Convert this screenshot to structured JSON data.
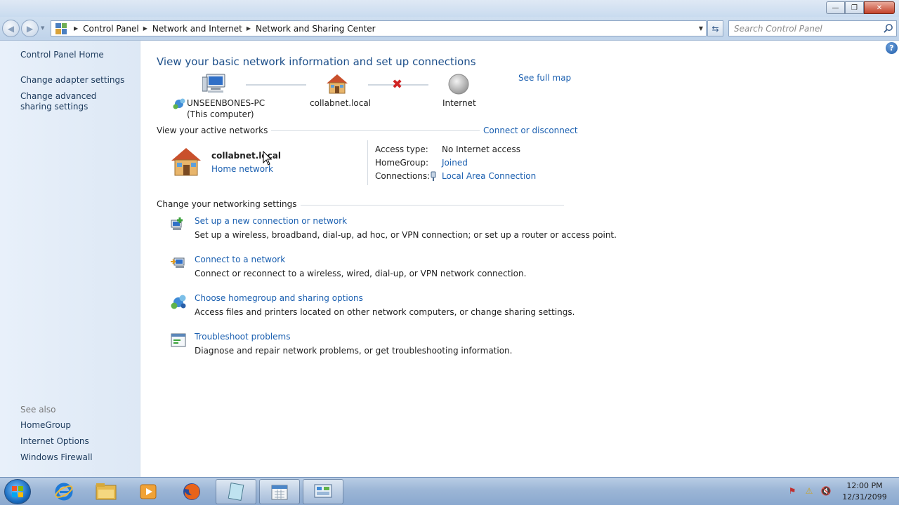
{
  "window": {
    "minimize_glyph": "—",
    "maximize_glyph": "❐",
    "close_glyph": "✕"
  },
  "nav": {
    "breadcrumb": [
      "Control Panel",
      "Network and Internet",
      "Network and Sharing Center"
    ],
    "search_placeholder": "Search Control Panel"
  },
  "sidebar": {
    "home": "Control Panel Home",
    "links": [
      "Change adapter settings",
      "Change advanced sharing settings"
    ],
    "see_also_label": "See also",
    "see_also": [
      "HomeGroup",
      "Internet Options",
      "Windows Firewall"
    ]
  },
  "main": {
    "heading": "View your basic network information and set up connections",
    "see_full_map": "See full map",
    "map": {
      "computer_name": "UNSEENBONES-PC",
      "computer_sub": "(This computer)",
      "network_name": "collabnet.local",
      "internet_label": "Internet",
      "internet_connected": false
    },
    "active_networks_title": "View your active networks",
    "connect_or_disconnect": "Connect or disconnect",
    "active_network": {
      "name": "collabnet.local",
      "type": "Home network",
      "access_type_label": "Access type:",
      "access_type_value": "No Internet access",
      "homegroup_label": "HomeGroup:",
      "homegroup_value": "Joined",
      "connections_label": "Connections:",
      "connections_value": "Local Area Connection"
    },
    "settings_title": "Change your networking settings",
    "tasks": [
      {
        "title": "Set up a new connection or network",
        "desc": "Set up a wireless, broadband, dial-up, ad hoc, or VPN connection; or set up a router or access point."
      },
      {
        "title": "Connect to a network",
        "desc": "Connect or reconnect to a wireless, wired, dial-up, or VPN network connection."
      },
      {
        "title": "Choose homegroup and sharing options",
        "desc": "Access files and printers located on other network computers, or change sharing settings."
      },
      {
        "title": "Troubleshoot problems",
        "desc": "Diagnose and repair network problems, or get troubleshooting information."
      }
    ]
  },
  "taskbar": {
    "time": "12:00 PM",
    "date": "12/31/2099",
    "pinned_icons": [
      "internet-explorer-icon",
      "windows-explorer-icon",
      "media-player-icon",
      "firefox-icon",
      "notepad-icon",
      "calendar-icon",
      "control-panel-icon"
    ]
  },
  "colors": {
    "link": "#1a5fb0",
    "heading": "#1d4f8a",
    "error_x": "#d02424"
  }
}
